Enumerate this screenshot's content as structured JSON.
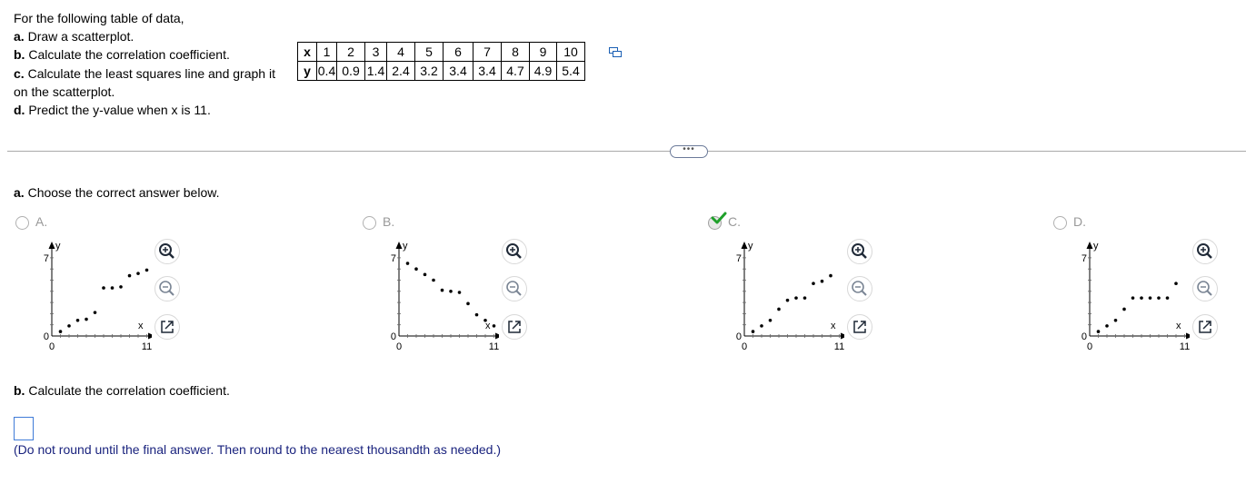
{
  "problem": {
    "intro": "For the following table of data,",
    "parts": [
      {
        "letter": "a.",
        "text": " Draw a scatterplot."
      },
      {
        "letter": "b.",
        "text": " Calculate the correlation coefficient."
      },
      {
        "letter": "c.",
        "text": " Calculate the least squares line and graph it on the scatterplot."
      },
      {
        "letter": "d.",
        "text": " Predict the y-value when x is 11."
      }
    ]
  },
  "table": {
    "x_label": "x",
    "y_label": "y",
    "x": [
      "1",
      "2",
      "3",
      "4",
      "5",
      "6",
      "7",
      "8",
      "9",
      "10"
    ],
    "y": [
      "0.4",
      "0.9",
      "1.4",
      "2.4",
      "3.2",
      "3.4",
      "3.4",
      "4.7",
      "4.9",
      "5.4"
    ]
  },
  "more_button": "•••",
  "question_a": {
    "letter": "a.",
    "text": " Choose the correct answer below."
  },
  "options": [
    {
      "label": "A.",
      "selected": false,
      "points": [
        [
          1,
          0.4
        ],
        [
          2,
          0.9
        ],
        [
          3,
          1.4
        ],
        [
          4,
          1.5
        ],
        [
          5,
          2.1
        ],
        [
          6,
          4.3
        ],
        [
          7,
          4.3
        ],
        [
          8,
          4.4
        ],
        [
          9,
          5.4
        ],
        [
          10,
          5.6
        ],
        [
          11,
          5.9
        ]
      ]
    },
    {
      "label": "B.",
      "selected": false,
      "points": [
        [
          1,
          6.5
        ],
        [
          2,
          6.0
        ],
        [
          3,
          5.5
        ],
        [
          4,
          5.0
        ],
        [
          5,
          4.1
        ],
        [
          6,
          4.0
        ],
        [
          7,
          3.9
        ],
        [
          8,
          2.9
        ],
        [
          9,
          1.9
        ],
        [
          10,
          1.4
        ],
        [
          11,
          0.9
        ]
      ]
    },
    {
      "label": "C.",
      "selected": true,
      "points": [
        [
          1,
          0.4
        ],
        [
          2,
          0.9
        ],
        [
          3,
          1.4
        ],
        [
          4,
          2.4
        ],
        [
          5,
          3.2
        ],
        [
          6,
          3.4
        ],
        [
          7,
          3.4
        ],
        [
          8,
          4.7
        ],
        [
          9,
          4.9
        ],
        [
          10,
          5.4
        ]
      ]
    },
    {
      "label": "D.",
      "selected": false,
      "points": [
        [
          1,
          0.4
        ],
        [
          2,
          0.9
        ],
        [
          3,
          1.4
        ],
        [
          4,
          2.4
        ],
        [
          5,
          3.4
        ],
        [
          6,
          3.4
        ],
        [
          7,
          3.4
        ],
        [
          8,
          3.4
        ],
        [
          9,
          3.4
        ],
        [
          10,
          4.7
        ]
      ]
    }
  ],
  "graph_axes": {
    "y_label": "y",
    "x_label": "x",
    "y_tick_max": "7",
    "origin_y": "0",
    "origin_x": "0",
    "x_tick_max": "11"
  },
  "question_b": {
    "letter": "b.",
    "text": " Calculate the correlation coefficient."
  },
  "answer_input": {
    "value": ""
  },
  "note": "(Do not round until the final answer. Then round to the nearest thousandth as needed.)",
  "colors": {
    "accent_check": "#1fa02a",
    "link_blue": "#1a237e",
    "input_border": "#3f7bd8",
    "icon_blue": "#1a5fb4"
  }
}
